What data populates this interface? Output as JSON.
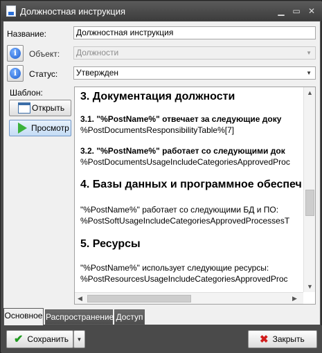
{
  "window": {
    "title": "Должностная инструкция"
  },
  "form": {
    "name_label": "Название:",
    "name_value": "Должностная инструкция",
    "object_label": "Объект:",
    "object_value": "Должности",
    "status_label": "Статус:",
    "status_value": "Утвержден",
    "template_label": "Шаблон:"
  },
  "template_buttons": {
    "open_label": "Открыть",
    "preview_label": "Просмотр"
  },
  "document": {
    "heading3": "3. Документация должности",
    "s31_bold": "3.1. \"%PostName%\" отвечает за следующие доку",
    "s31_text": "%PostDocumentsResponsibilityTable%[7]",
    "s32_bold": "3.2. \"%PostName%\" работает со следующими док",
    "s32_text": "%PostDocumentsUsageIncludeCategoriesApprovedProc",
    "heading4": "4. Базы данных и программное обеспеч",
    "s4_line1": "\"%PostName%\" работает со следующими БД и ПО:",
    "s4_line2": "%PostSoftUsageIncludeCategoriesApprovedProcessesT",
    "heading5": "5. Ресурсы",
    "s5_line1": "\"%PostName%\" использует следующие ресурсы:",
    "s5_line2": "%PostResourcesUsageIncludeCategoriesApprovedProc"
  },
  "tabs": [
    {
      "label": "Основное"
    },
    {
      "label": "Распространение"
    },
    {
      "label": "Доступ"
    }
  ],
  "footer": {
    "save_label": "Сохранить",
    "close_label": "Закрыть"
  },
  "colors": {
    "title_bg": "#3c3c3c",
    "client_bg": "#f0f0f0",
    "save_icon": "#1f9a1f",
    "close_icon": "#d11b1b",
    "preview_icon": "#3bb23b"
  }
}
